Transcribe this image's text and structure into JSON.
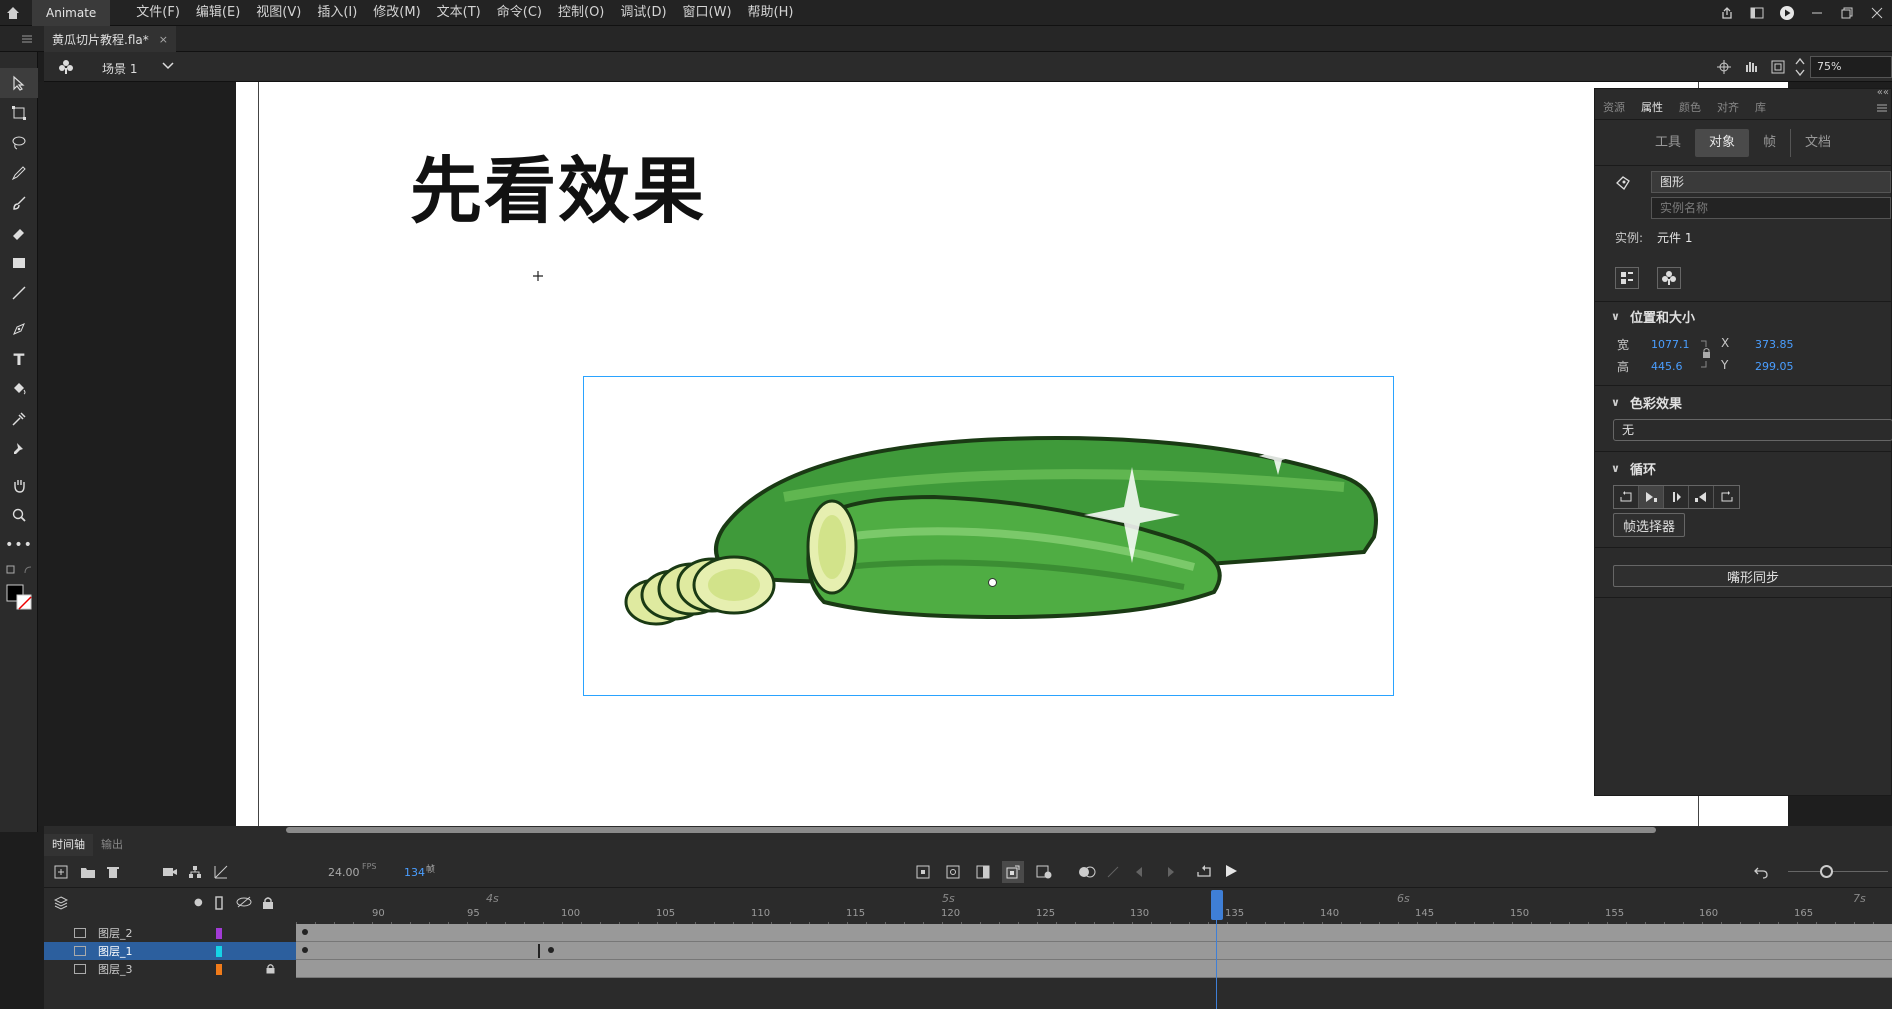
{
  "app": {
    "name": "Animate"
  },
  "menu": [
    "文件(F)",
    "编辑(E)",
    "视图(V)",
    "插入(I)",
    "修改(M)",
    "文本(T)",
    "命令(C)",
    "控制(O)",
    "调试(D)",
    "窗口(W)",
    "帮助(H)"
  ],
  "document_tab": {
    "title": "黄瓜切片教程.fla*",
    "close": "×"
  },
  "scene": {
    "name": "场景 1",
    "zoom": "75%"
  },
  "stage": {
    "title_text": "先看效果"
  },
  "properties": {
    "panel_tabs": [
      "资源",
      "属性",
      "颜色",
      "对齐",
      "库"
    ],
    "active_panel_tab": "属性",
    "sub_tabs": [
      "工具",
      "对象",
      "帧",
      "文档"
    ],
    "active_sub_tab": "对象",
    "symbol_type": "图形",
    "instance_name_placeholder": "实例名称",
    "instance_label": "实例:",
    "instance_value": "元件 1",
    "section_position": "位置和大小",
    "width_label": "宽",
    "width_value": "1077.1",
    "height_label": "高",
    "height_value": "445.6",
    "x_label": "X",
    "x_value": "373.85",
    "y_label": "Y",
    "y_value": "299.05",
    "section_color": "色彩效果",
    "color_effect_value": "无",
    "section_loop": "循环",
    "frame_picker_label": "帧选择器",
    "lip_sync_label": "嘴形同步"
  },
  "timeline": {
    "tabs": [
      "时间轴",
      "输出"
    ],
    "active_tab": "时间轴",
    "fps": "24.00",
    "fps_unit": "FPS",
    "current_frame": "134",
    "frame_unit": "帧",
    "layers": [
      {
        "name": "图层_2",
        "color": "#a23bd6",
        "locked": false,
        "selected": false
      },
      {
        "name": "图层_1",
        "color": "#16d3e6",
        "locked": false,
        "selected": true
      },
      {
        "name": "图层_3",
        "color": "#f07b1a",
        "locked": true,
        "selected": false
      }
    ],
    "frame_ticks": [
      "90",
      "95",
      "100",
      "105",
      "110",
      "115",
      "120",
      "125",
      "130",
      "135",
      "140",
      "145",
      "150",
      "155",
      "160",
      "165"
    ],
    "second_labels": [
      "4s",
      "5s",
      "6s",
      "7s"
    ]
  },
  "colors": {
    "accent": "#3f7fd6",
    "selection": "#2aa3ff"
  }
}
